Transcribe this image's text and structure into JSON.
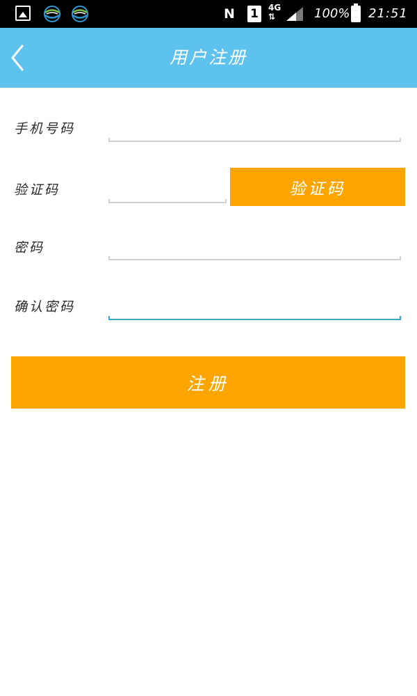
{
  "status_bar": {
    "nfc_label": "N",
    "sim_label": "1",
    "network_label": "4G",
    "battery_percent": "100%",
    "time": "21:51",
    "icons": [
      "gallery-icon",
      "china-mobile-icon",
      "china-mobile-icon",
      "nfc-icon",
      "sim-icon",
      "network-4g-icon",
      "signal-icon",
      "battery-icon"
    ]
  },
  "header": {
    "title": "用户注册",
    "back_icon": "chevron-left-icon",
    "background_color": "#5ec2ee"
  },
  "form": {
    "phone_label": "手机号码",
    "phone_value": "",
    "code_label": "验证码",
    "code_value": "",
    "code_button_label": "验证码",
    "password_label": "密码",
    "password_value": "",
    "confirm_label": "确认密码",
    "confirm_value": "",
    "accent_color": "#fca500"
  },
  "register_button_label": "注册"
}
